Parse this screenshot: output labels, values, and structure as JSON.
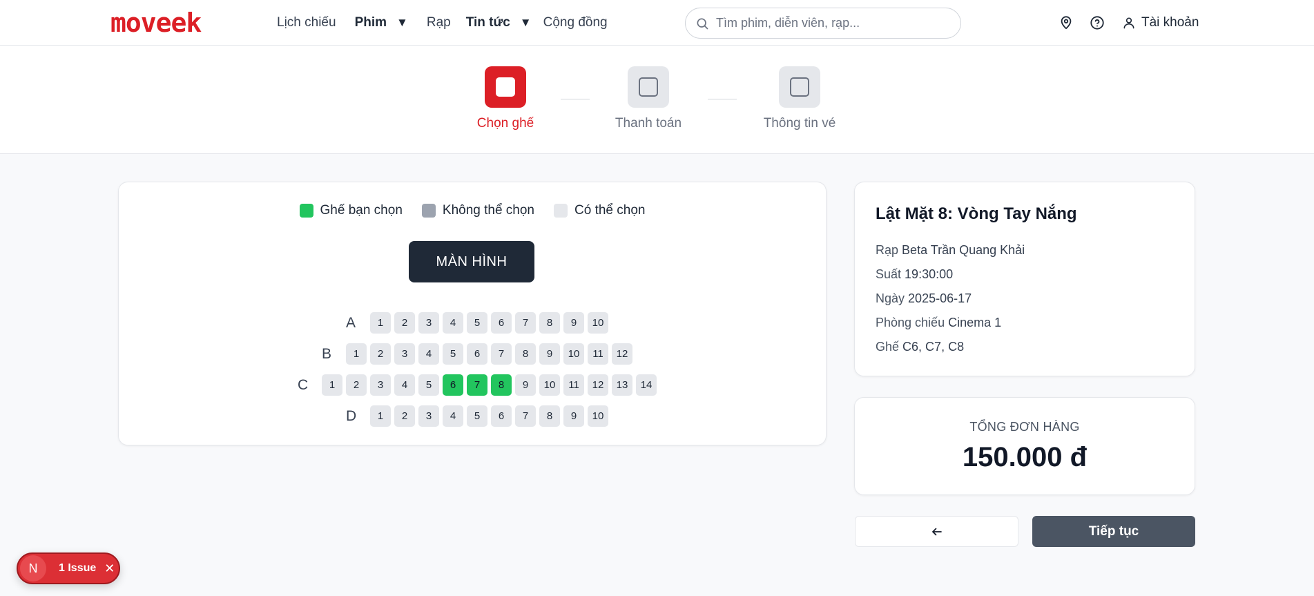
{
  "header": {
    "logo": "moveek",
    "nav": [
      {
        "label": "Lịch chiếu"
      },
      {
        "label": "Phim"
      },
      {
        "label": "Rạp"
      },
      {
        "label": "Tin tức"
      },
      {
        "label": "Cộng đồng"
      }
    ],
    "search_placeholder": "Tìm phim, diễn viên, rạp...",
    "account_label": "Tài khoản"
  },
  "stepper": {
    "steps": [
      {
        "label": "Chọn ghế",
        "active": true
      },
      {
        "label": "Thanh toán",
        "active": false
      },
      {
        "label": "Thông tin vé",
        "active": false
      }
    ]
  },
  "legend": {
    "selected": "Ghế bạn chọn",
    "unavailable": "Không thể chọn",
    "available": "Có thể chọn"
  },
  "screen_label": "MÀN HÌNH",
  "seat_rows": [
    {
      "label": "A",
      "seats": [
        "1",
        "2",
        "3",
        "4",
        "5",
        "6",
        "7",
        "8",
        "9",
        "10"
      ],
      "selected": []
    },
    {
      "label": "B",
      "seats": [
        "1",
        "2",
        "3",
        "4",
        "5",
        "6",
        "7",
        "8",
        "9",
        "10",
        "11",
        "12"
      ],
      "selected": []
    },
    {
      "label": "C",
      "seats": [
        "1",
        "2",
        "3",
        "4",
        "5",
        "6",
        "7",
        "8",
        "9",
        "10",
        "11",
        "12",
        "13",
        "14"
      ],
      "selected": [
        "6",
        "7",
        "8"
      ]
    },
    {
      "label": "D",
      "seats": [
        "1",
        "2",
        "3",
        "4",
        "5",
        "6",
        "7",
        "8",
        "9",
        "10"
      ],
      "selected": []
    }
  ],
  "booking": {
    "movie_title": "Lật Mặt 8: Vòng Tay Nắng",
    "cinema_label": "Rạp",
    "cinema": "Beta Trần Quang Khải",
    "showtime_label": "Suất",
    "showtime": "19:30:00",
    "date_label": "Ngày",
    "date": "2025-06-17",
    "room_label": "Phòng chiếu",
    "room": "Cinema 1",
    "seats_label": "Ghế",
    "seats": "C6, C7, C8"
  },
  "total": {
    "label": "TỔNG ĐƠN HÀNG",
    "value": "150.000 đ"
  },
  "actions": {
    "continue_label": "Tiếp tục"
  },
  "issue_badge": {
    "logo": "N",
    "text": "1 Issue"
  },
  "colors": {
    "brand": "#dc1f26",
    "seat_selected": "#22c55e",
    "seat_unavailable": "#9ca3af",
    "seat_available": "#e5e7eb",
    "screen": "#1f2937",
    "primary_button": "#4b5563"
  }
}
